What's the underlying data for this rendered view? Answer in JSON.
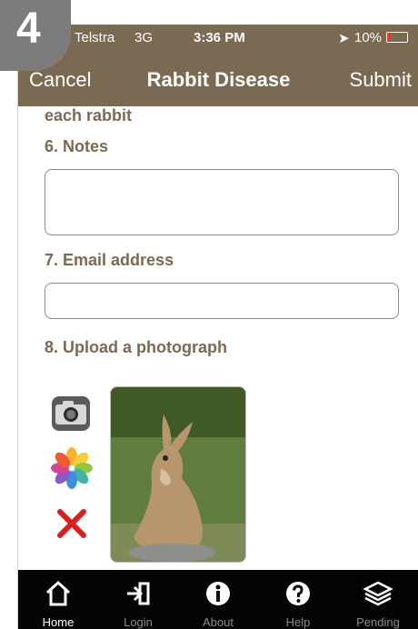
{
  "step_badge": "4",
  "status_bar": {
    "carrier": "Telstra",
    "network": "3G",
    "time": "3:36 PM",
    "battery": "10%"
  },
  "nav": {
    "cancel": "Cancel",
    "title": "Rabbit Disease",
    "submit": "Submit"
  },
  "form": {
    "previous_text": "each rabbit",
    "notes_label": "6. Notes",
    "notes_value": "",
    "email_label": "7. Email address",
    "email_value": "",
    "photo_label": "8. Upload a photograph"
  },
  "tabs": [
    {
      "label": "Home",
      "icon": "home-icon",
      "active": true
    },
    {
      "label": "Login",
      "icon": "login-icon",
      "active": false
    },
    {
      "label": "About",
      "icon": "info-icon",
      "active": false
    },
    {
      "label": "Help",
      "icon": "help-icon",
      "active": false
    },
    {
      "label": "Pending",
      "icon": "layers-icon",
      "active": false
    }
  ],
  "colors": {
    "header": "#7a6a52",
    "label": "#7a6a52",
    "tabbar": "#050505",
    "badge": "#7c7c7c"
  }
}
